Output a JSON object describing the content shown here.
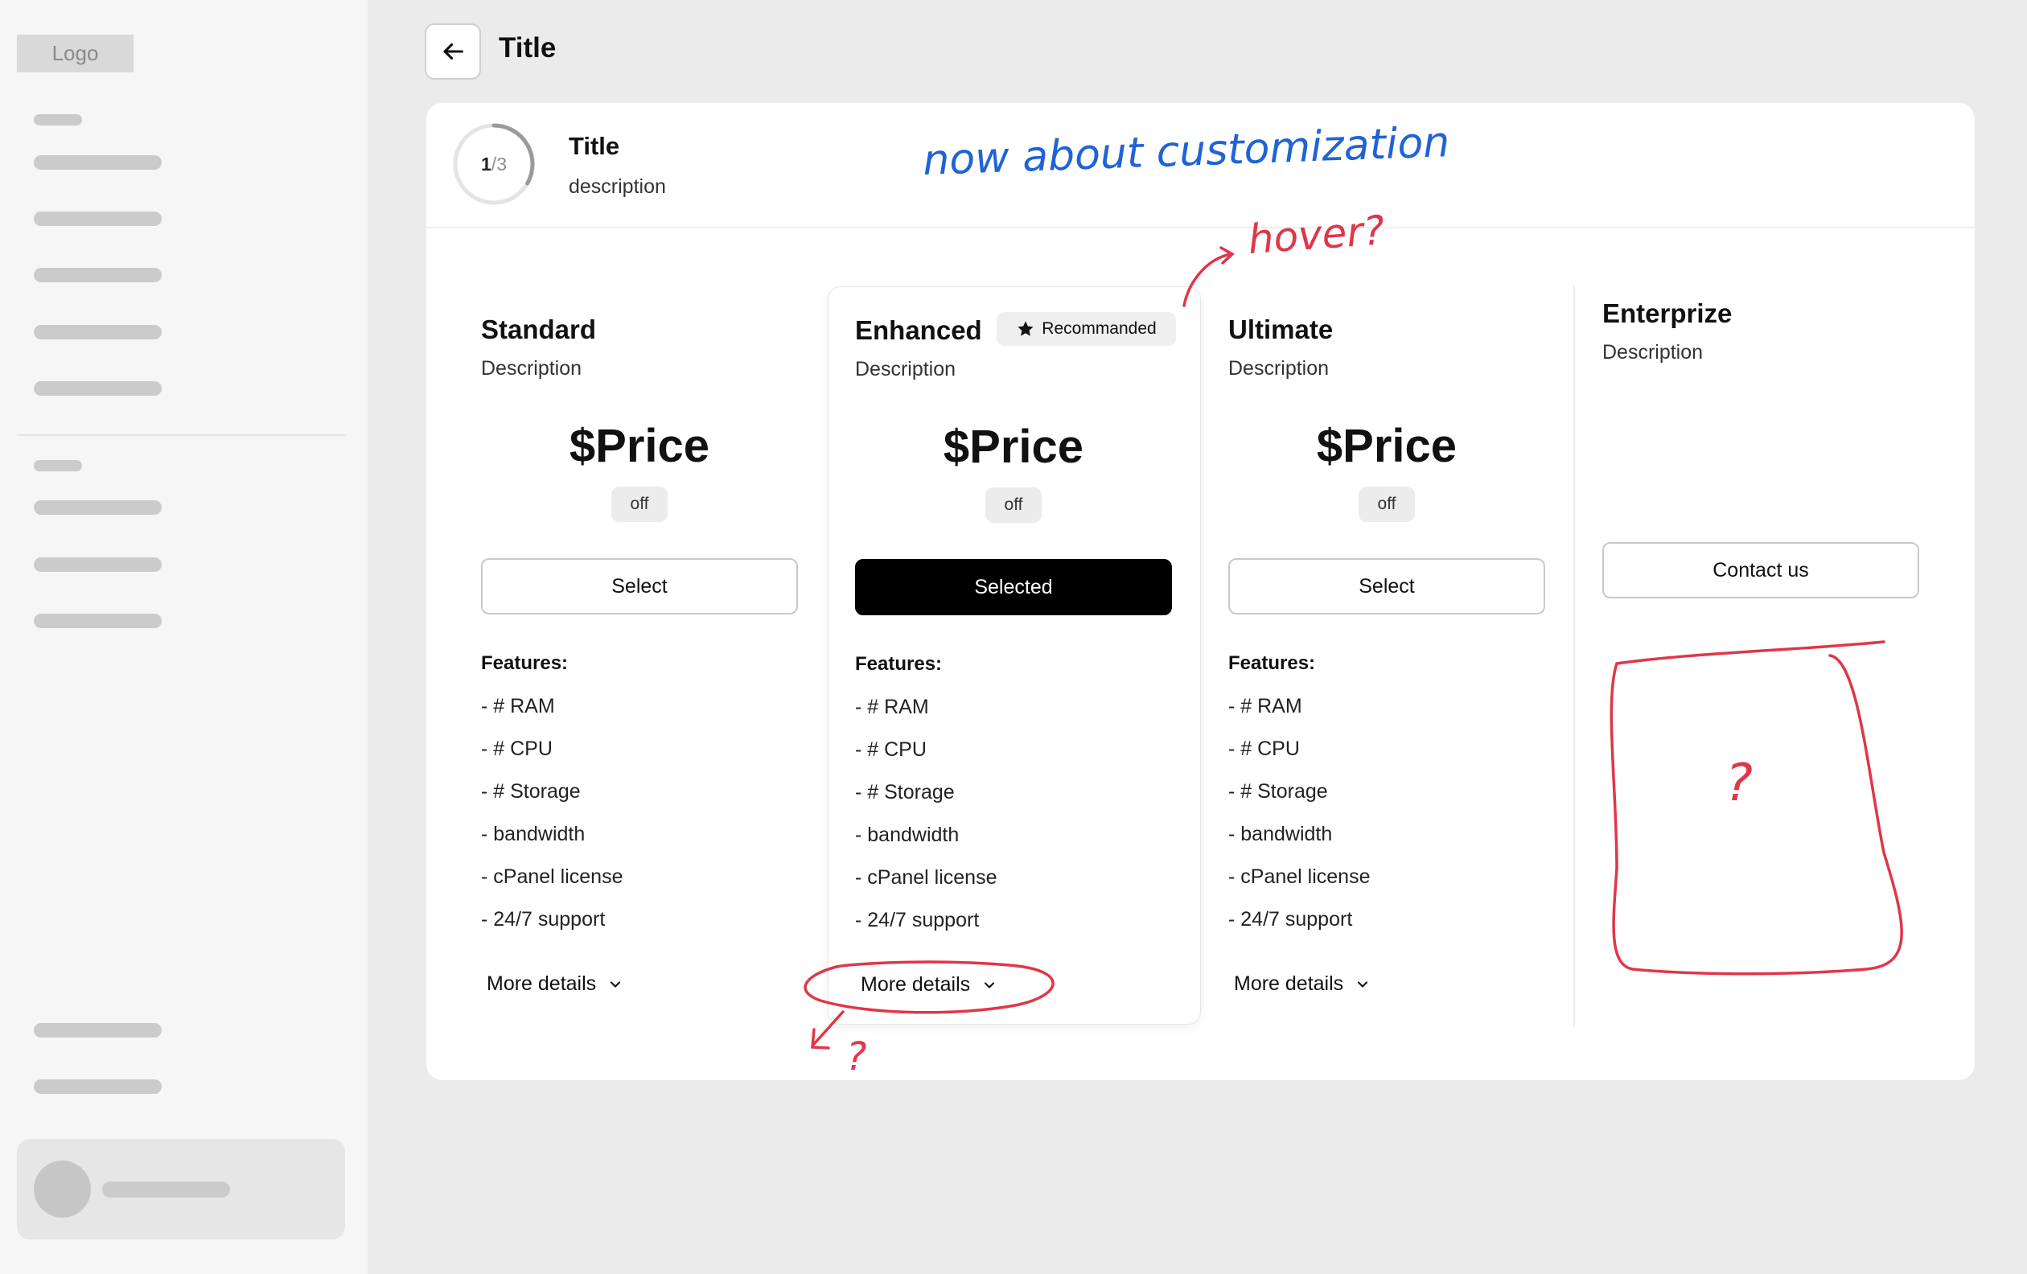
{
  "sidebar": {
    "logo": "Logo"
  },
  "header": {
    "title": "Title"
  },
  "step": {
    "current": "1",
    "separator": "/",
    "total": "3",
    "fraction": 0.333,
    "title": "Title",
    "description": "description"
  },
  "plans": [
    {
      "name": "Standard",
      "description": "Description",
      "price": "$Price",
      "discount": "off",
      "button": "Select",
      "features_label": "Features:",
      "features": [
        "- # RAM",
        "- # CPU",
        "- # Storage",
        "- bandwidth",
        "- cPanel license",
        "- 24/7 support"
      ],
      "more": "More details"
    },
    {
      "name": "Enhanced",
      "badge": "Recommanded",
      "description": "Description",
      "price": "$Price",
      "discount": "off",
      "button": "Selected",
      "features_label": "Features:",
      "features": [
        "- # RAM",
        "- # CPU",
        "- # Storage",
        "- bandwidth",
        "- cPanel license",
        "- 24/7 support"
      ],
      "more": "More details"
    },
    {
      "name": "Ultimate",
      "description": "Description",
      "price": "$Price",
      "discount": "off",
      "button": "Select",
      "features_label": "Features:",
      "features": [
        "- # RAM",
        "- # CPU",
        "- # Storage",
        "- bandwidth",
        "- cPanel license",
        "- 24/7 support"
      ],
      "more": "More details"
    },
    {
      "name": "Enterprize",
      "description": "Description",
      "button": "Contact us"
    }
  ],
  "annotations": {
    "customization": "now about customization",
    "hover": "hover?",
    "more_question": "?",
    "box_question": "?"
  },
  "colors": {
    "annotation_red": "#e0364a",
    "annotation_blue": "#1f63d6",
    "selected_button": "#000000"
  }
}
